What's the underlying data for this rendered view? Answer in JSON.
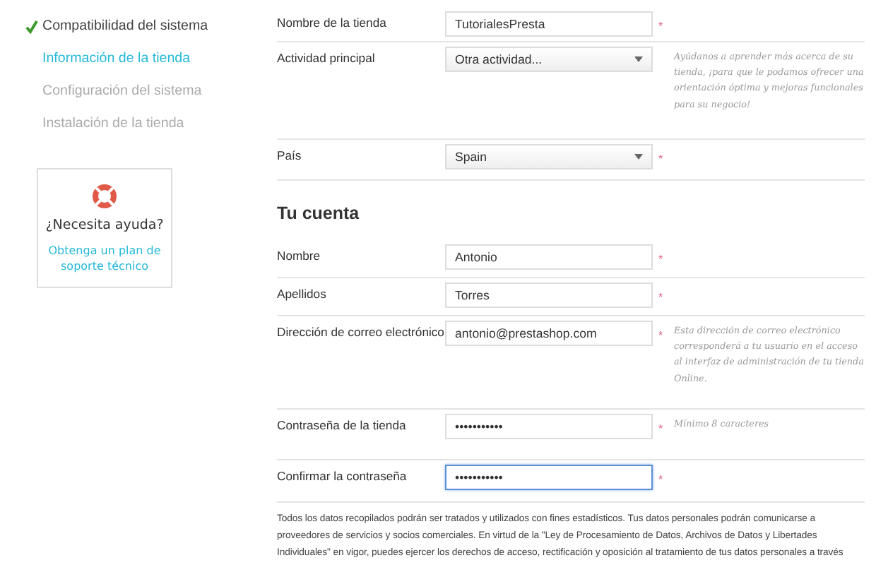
{
  "steps": [
    {
      "label": "Compatibilidad del sistema",
      "done": true,
      "selected": false
    },
    {
      "label": "Información de la tienda",
      "done": false,
      "selected": true
    },
    {
      "label": "Configuración del sistema",
      "done": false,
      "selected": false
    },
    {
      "label": "Instalación de la tienda",
      "done": false,
      "selected": false
    }
  ],
  "help": {
    "title": "¿Necesita ayuda?",
    "link": "Obtenga un plan de soporte técnico"
  },
  "store_fields": [
    {
      "label": "Nombre de la tienda",
      "kind": "text",
      "value": "TutorialesPresta",
      "required_mark": "*",
      "focused": false
    },
    {
      "label": "Actividad principal",
      "kind": "select",
      "value": "Otra actividad...",
      "focused": false,
      "hint": "Ayúdanos a aprender más acerca de su tienda, ¡para que le podamos ofrecer una orientación óptima y mejoras funcionales para su negocio!"
    },
    {
      "label": "País",
      "kind": "select",
      "value": "Spain",
      "required_mark": "*",
      "focused": false
    }
  ],
  "account_heading": "Tu cuenta",
  "account_fields": [
    {
      "label": "Nombre",
      "kind": "text",
      "value": "Antonio",
      "required_mark": "*",
      "focused": false
    },
    {
      "label": "Apellidos",
      "kind": "text",
      "value": "Torres",
      "required_mark": "*",
      "focused": false
    },
    {
      "label": "Dirección de correo electrónico",
      "kind": "text",
      "value": "antonio@prestashop.com",
      "required_mark": "*",
      "focused": false,
      "hint": "Esta dirección de correo electrónico corresponderá a tu usuario en el acceso al interfaz de administración de tu tienda Online."
    },
    {
      "label": "Contraseña de la tienda",
      "kind": "text",
      "value": "•••••••••••",
      "required_mark": "*",
      "focused": false,
      "hint": "Mínimo 8 caracteres"
    },
    {
      "label": "Confirmar la contraseña",
      "kind": "text",
      "value": "•••••••••••",
      "required_mark": "*",
      "focused": true
    }
  ],
  "notice": "Todos los datos recopilados podrán ser tratados y utilizados con fines estadísticos. Tus datos personales podrán comunicarse a proveedores de servicios y socios comerciales. En virtud de la \"Ley de Procesamiento de Datos, Archivos de Datos y Libertades Individuales\" en vigor, puedes ejercer los derechos de acceso, rectificación y oposición al tratamiento de tus datos personales a través"
}
